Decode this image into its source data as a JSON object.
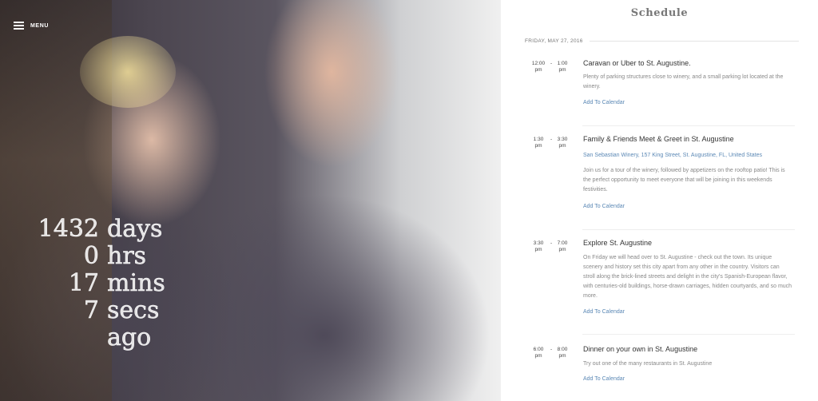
{
  "nav": {
    "menu_label": "MENU"
  },
  "countdown": {
    "days": "1432",
    "days_unit": "days",
    "hours": "0",
    "hours_unit": "hrs",
    "mins": "17",
    "mins_unit": "mins",
    "secs": "7",
    "secs_unit": "secs",
    "suffix": "ago"
  },
  "schedule": {
    "title": "Schedule",
    "date": "FRIDAY, MAY 27, 2016",
    "events": [
      {
        "start": "12:00",
        "start_ampm": "pm",
        "end": "1:00",
        "end_ampm": "pm",
        "title": "Caravan or Uber to St. Augustine.",
        "location": "",
        "description": "Plenty of parking structures close to winery, and a small parking lot located at the winery.",
        "calendar_label": "Add To Calendar"
      },
      {
        "start": "1:30",
        "start_ampm": "pm",
        "end": "3:30",
        "end_ampm": "pm",
        "title": "Family & Friends Meet & Greet in St. Augustine",
        "location": "San Sebastian Winery, 157 King Street, St. Augustine, FL, United States",
        "description": "Join us for a tour of the winery, followed by appetizers on the rooftop patio! This is the perfect opportunity to meet everyone that will be joining in this weekends festivities.",
        "calendar_label": "Add To Calendar"
      },
      {
        "start": "3:30",
        "start_ampm": "pm",
        "end": "7:00",
        "end_ampm": "pm",
        "title": "Explore St. Augustine",
        "location": "",
        "description": "On Friday we will head over to St. Augustine - check out the town. Its unique scenery and history set this city apart from any other in the country. Visitors can stroll along the brick-lined streets and delight in the city's Spanish-European flavor, with centuries-old buildings, horse-drawn carriages, hidden courtyards, and so much more.",
        "calendar_label": "Add To Calendar"
      },
      {
        "start": "6:00",
        "start_ampm": "pm",
        "end": "8:00",
        "end_ampm": "pm",
        "title": "Dinner on your own in St. Augustine",
        "location": "",
        "description": "Try out one of the many restaurants in St. Augustine",
        "calendar_label": "Add To Calendar"
      }
    ]
  },
  "icons": {
    "menu": "hamburger-icon"
  }
}
